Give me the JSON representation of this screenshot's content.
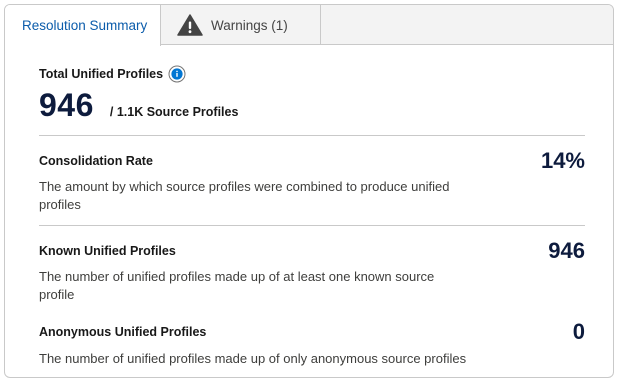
{
  "tabs": {
    "summary_label": "Resolution Summary",
    "warnings_label": "Warnings (1)"
  },
  "total": {
    "label": "Total Unified Profiles",
    "value": "946",
    "source": "/ 1.1K Source Profiles"
  },
  "metrics": [
    {
      "title": "Consolidation Rate",
      "value": "14%",
      "description": "The amount by which source profiles were combined to produce unified profiles"
    },
    {
      "title": "Known Unified Profiles",
      "value": "946",
      "description": "The number of unified profiles made up of at least one known source profile"
    },
    {
      "title": "Anonymous Unified Profiles",
      "value": "0",
      "description": "The number of unified profiles made up of only anonymous source profiles"
    }
  ],
  "colors": {
    "active_tab_text": "#0b5cab",
    "big_number": "#0d1b3d",
    "info_icon": "#0176d3",
    "warning_icon": "#444444"
  },
  "icons": {
    "info": "info-icon",
    "warning": "warning-icon"
  }
}
